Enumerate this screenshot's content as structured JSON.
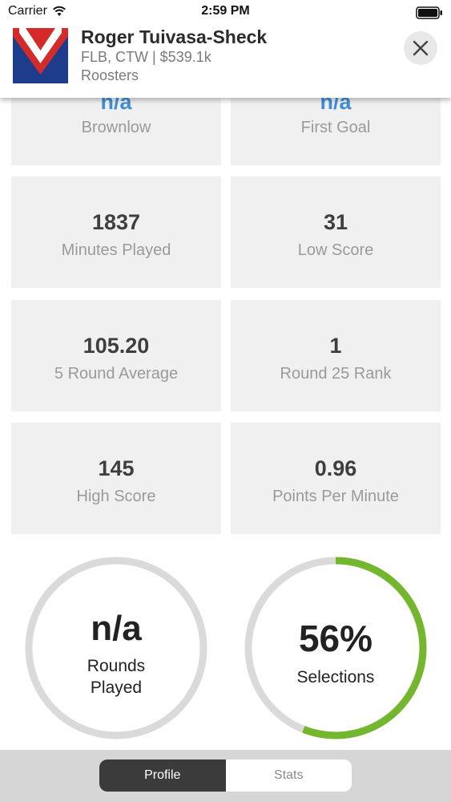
{
  "status_bar": {
    "carrier": "Carrier",
    "time": "2:59 PM"
  },
  "player": {
    "name": "Roger Tuivasa-Sheck",
    "meta": "FLB, CTW | $539.1k",
    "club": "Roosters"
  },
  "stats": [
    {
      "value": "n/a",
      "label": "Brownlow"
    },
    {
      "value": "n/a",
      "label": "First Goal"
    },
    {
      "value": "1837",
      "label": "Minutes Played"
    },
    {
      "value": "31",
      "label": "Low Score"
    },
    {
      "value": "105.20",
      "label": "5 Round Average"
    },
    {
      "value": "1",
      "label": "Round 25 Rank"
    },
    {
      "value": "145",
      "label": "High Score"
    },
    {
      "value": "0.96",
      "label": "Points Per Minute"
    }
  ],
  "rings": {
    "rounds": {
      "value": "n/a",
      "label_line1": "Rounds",
      "label_line2": "Played",
      "progress": 0
    },
    "selections": {
      "value": "56%",
      "label": "Selections",
      "progress": 0.56
    }
  },
  "tabs": [
    {
      "label": "Profile",
      "active": true
    },
    {
      "label": "Stats",
      "active": false
    }
  ],
  "colors": {
    "accent_blue": "#3f8fd6",
    "ring_green": "#74b62e",
    "ring_track": "#dadada",
    "club_red": "#d42a2a",
    "club_navy": "#1d3d8c"
  }
}
